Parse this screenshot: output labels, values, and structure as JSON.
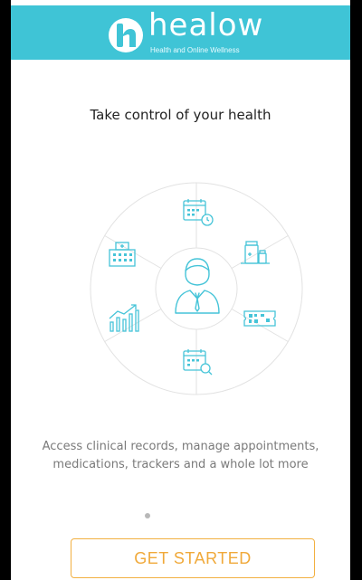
{
  "header": {
    "brand_name": "healow",
    "tagline": "Health and Online Wellness",
    "color": "#3fc4d6"
  },
  "main": {
    "headline": "Take control of your health",
    "features_wheel": {
      "center_icon": "doctor-icon",
      "segments": [
        "calendar-clock-icon",
        "medications-icon",
        "ticket-qr-icon",
        "calendar-search-icon",
        "trend-chart-icon",
        "hospital-icon"
      ],
      "accent_color": "#45c4d8"
    },
    "description_line1": "Access clinical records, manage appointments,",
    "description_line2": "medications, trackers and a whole lot more",
    "pagination": {
      "current_page": 1
    },
    "cta_label": "GET STARTED",
    "cta_color": "#f0a93a"
  }
}
